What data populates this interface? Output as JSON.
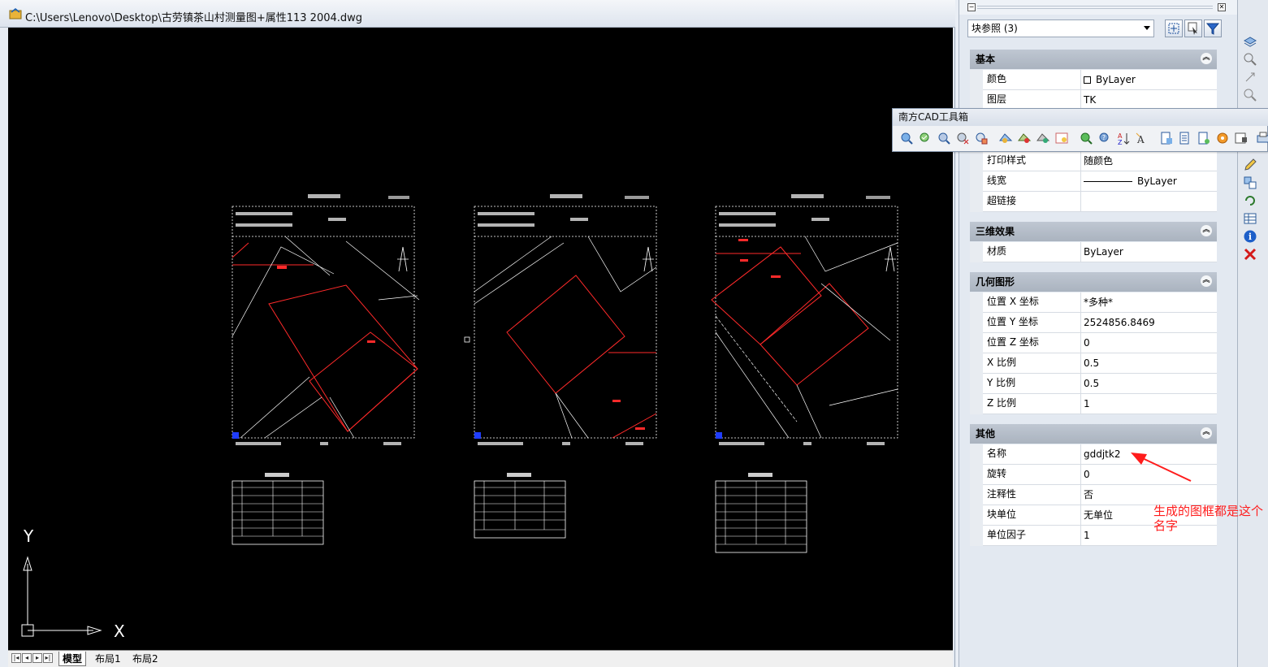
{
  "window": {
    "title": "C:\\Users\\Lenovo\\Desktop\\古劳镇茶山村测量图+属性113 2004.dwg"
  },
  "canvas": {
    "background": "#000000",
    "axis_x_label": "X",
    "axis_y_label": "Y",
    "entity_color_white": "#ffffff",
    "entity_color_red": "#ff0000",
    "grip_color": "#1f3dff"
  },
  "layout_tabs": [
    {
      "label": "模型",
      "active": true
    },
    {
      "label": "布局1",
      "active": false
    },
    {
      "label": "布局2",
      "active": false
    }
  ],
  "properties": {
    "object_selector": "块参照 (3)",
    "sections": [
      {
        "title": "基本",
        "rows": [
          {
            "name": "颜色",
            "value": "ByLayer",
            "swatch": true
          },
          {
            "name": "图层",
            "value": "TK"
          },
          {
            "name": "打印样式",
            "value": "随颜色"
          },
          {
            "name": "线宽",
            "value": "ByLayer",
            "line": true
          },
          {
            "name": "超链接",
            "value": ""
          }
        ]
      },
      {
        "title": "三维效果",
        "rows": [
          {
            "name": "材质",
            "value": "ByLayer"
          }
        ]
      },
      {
        "title": "几何图形",
        "rows": [
          {
            "name": "位置 X 坐标",
            "value": "*多种*"
          },
          {
            "name": "位置 Y 坐标",
            "value": "2524856.8469"
          },
          {
            "name": "位置 Z 坐标",
            "value": "0"
          },
          {
            "name": "X 比例",
            "value": "0.5"
          },
          {
            "name": "Y 比例",
            "value": "0.5"
          },
          {
            "name": "Z 比例",
            "value": "1"
          }
        ]
      },
      {
        "title": "其他",
        "rows": [
          {
            "name": "名称",
            "value": "gddjtk2"
          },
          {
            "name": "旋转",
            "value": "0"
          },
          {
            "name": "注释性",
            "value": "否"
          },
          {
            "name": "块单位",
            "value": "无单位"
          },
          {
            "name": "单位因子",
            "value": "1"
          }
        ]
      }
    ]
  },
  "toolbox": {
    "title": "南方CAD工具箱"
  },
  "annotation": {
    "text": "生成的图框都是这个名字",
    "color": "#ff1c1c"
  }
}
